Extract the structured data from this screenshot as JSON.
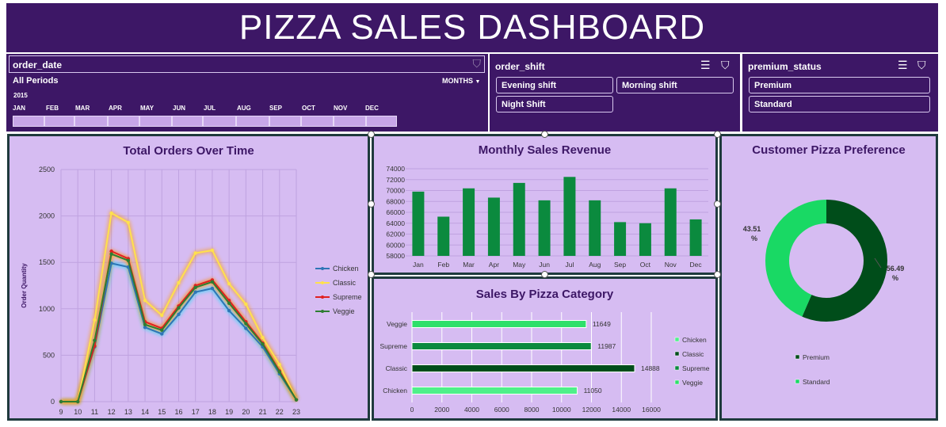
{
  "header": {
    "title": "PIZZA SALES DASHBOARD"
  },
  "colors": {
    "header_bg": "#3d1766",
    "panel_bg": "#d6bcf2",
    "bar_green": "#0b8a3e"
  },
  "slicers": {
    "order_date": {
      "field": "order_date",
      "period": "All Periods",
      "granularity": "MONTHS",
      "year": "2015",
      "months": [
        "JAN",
        "FEB",
        "MAR",
        "APR",
        "MAY",
        "JUN",
        "JUL",
        "AUG",
        "SEP",
        "OCT",
        "NOV",
        "DEC"
      ],
      "filter_icon": "clear-filter-icon",
      "dropdown_icon": "chevron-down-icon"
    },
    "order_shift": {
      "field": "order_shift",
      "items": [
        "Evening shift",
        "Morning shift",
        "Night Shift"
      ],
      "multiselect_icon": "multi-select-icon",
      "filter_icon": "clear-filter-icon"
    },
    "premium_status": {
      "field": "premium_status",
      "items": [
        "Premium",
        "Standard"
      ],
      "multiselect_icon": "multi-select-icon",
      "filter_icon": "clear-filter-icon"
    }
  },
  "chart_data": [
    {
      "type": "line",
      "title": "Total Orders Over Time",
      "ylabel": "Order Quantity",
      "xlabel": "",
      "x": [
        9,
        10,
        11,
        12,
        13,
        14,
        15,
        16,
        17,
        18,
        19,
        20,
        21,
        22,
        23
      ],
      "ylim": [
        0,
        2500
      ],
      "yticks": [
        0,
        500,
        1000,
        1500,
        2000,
        2500
      ],
      "grid": true,
      "legend": "right",
      "series": [
        {
          "name": "Chicken",
          "color": "#2e75b6",
          "values": [
            0,
            0,
            590,
            1490,
            1450,
            800,
            730,
            940,
            1180,
            1220,
            980,
            790,
            590,
            300,
            20
          ]
        },
        {
          "name": "Classic",
          "color": "#ffe14d",
          "values": [
            0,
            0,
            880,
            2030,
            1930,
            1090,
            930,
            1280,
            1600,
            1630,
            1270,
            1050,
            690,
            400,
            20
          ]
        },
        {
          "name": "Supreme",
          "color": "#e02020",
          "values": [
            0,
            0,
            600,
            1620,
            1540,
            860,
            790,
            1030,
            1250,
            1310,
            1090,
            860,
            630,
            330,
            20
          ]
        },
        {
          "name": "Veggie",
          "color": "#2e7d32",
          "values": [
            0,
            0,
            660,
            1590,
            1520,
            830,
            770,
            1010,
            1230,
            1290,
            1060,
            840,
            620,
            320,
            20
          ]
        }
      ]
    },
    {
      "type": "bar",
      "title": "Monthly Sales Revenue",
      "categories": [
        "Jan",
        "Feb",
        "Mar",
        "Apr",
        "May",
        "Jun",
        "Jul",
        "Aug",
        "Sep",
        "Oct",
        "Nov",
        "Dec"
      ],
      "values": [
        69800,
        65200,
        70400,
        68700,
        71400,
        68200,
        72500,
        68200,
        64200,
        64000,
        70400,
        64700
      ],
      "ylim": [
        58000,
        74000
      ],
      "yticks": [
        58000,
        60000,
        62000,
        64000,
        66000,
        68000,
        70000,
        72000,
        74000
      ],
      "grid": true
    },
    {
      "type": "bar",
      "orientation": "horizontal",
      "title": "Sales By Pizza Category",
      "categories": [
        "Veggie",
        "Supreme",
        "Classic",
        "Chicken"
      ],
      "values": [
        11649,
        11987,
        14888,
        11050
      ],
      "xlim": [
        0,
        16000
      ],
      "xticks": [
        0,
        2000,
        4000,
        6000,
        8000,
        10000,
        12000,
        14000,
        16000
      ],
      "colors": [
        "#2ee06a",
        "#0b8a3e",
        "#004d1a",
        "#4ff08a"
      ],
      "legend": "right",
      "legend_items": [
        "Chicken",
        "Classic",
        "Supreme",
        "Veggie"
      ],
      "legend_colors": [
        "#4ff08a",
        "#004d1a",
        "#0b8a3e",
        "#2ee06a"
      ]
    },
    {
      "type": "pie",
      "donut": true,
      "title": "Customer Pizza Preference",
      "labels": [
        "Premium",
        "Standard"
      ],
      "values": [
        56.49,
        43.51
      ],
      "value_labels": [
        "56.49 %",
        "43.51 %"
      ],
      "colors": [
        "#004d1a",
        "#19d964"
      ],
      "legend": "bottom"
    }
  ]
}
